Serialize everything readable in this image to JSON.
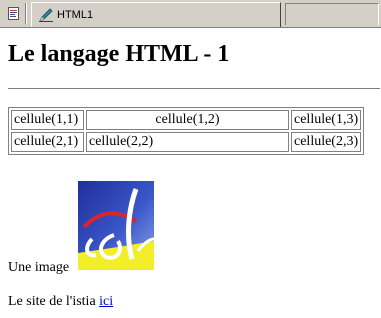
{
  "tabbar": {
    "tab_label": "HTML1"
  },
  "page": {
    "title": "Le langage HTML - 1",
    "table": {
      "rows": [
        [
          "cellule(1,1)",
          "cellule(1,2)",
          "cellule(1,3)"
        ],
        [
          "cellule(2,1)",
          "cellule(2,2)",
          "cellule(2,3)"
        ]
      ]
    },
    "image_label": "Une image",
    "site_text": "Le site de l'istia",
    "site_link": "ici"
  },
  "icons": {
    "doc": "document-icon",
    "tab": "html-editor-icon",
    "logo": "istia-logo"
  },
  "colors": {
    "chrome": "#d4d0c8",
    "link": "#0000cc",
    "logo_blue": "#2a3fb0",
    "logo_yellow": "#f2ee2a"
  }
}
